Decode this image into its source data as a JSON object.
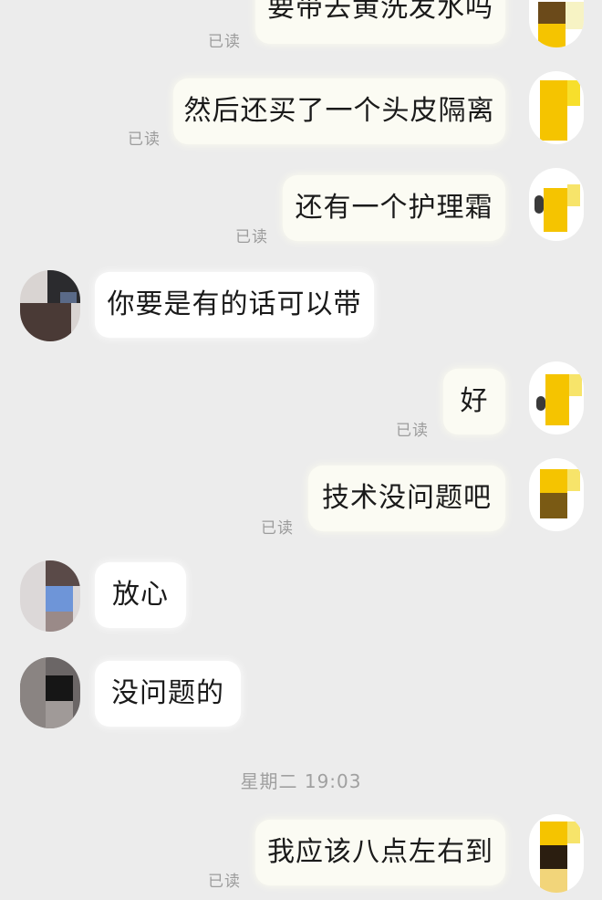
{
  "read_label": "已读",
  "messages": [
    {
      "side": "right",
      "text": "要带去黄洗发水吗"
    },
    {
      "side": "right",
      "text": "然后还买了一个头皮隔离"
    },
    {
      "side": "right",
      "text": "还有一个护理霜"
    },
    {
      "side": "left",
      "text": "你要是有的话可以带"
    },
    {
      "side": "right",
      "text": "好"
    },
    {
      "side": "right",
      "text": "技术没问题吧"
    },
    {
      "side": "left",
      "text": "放心"
    },
    {
      "side": "left",
      "text": "没问题的"
    },
    {
      "side": "right",
      "text": "我应该八点左右到"
    }
  ],
  "timestamp": "星期二 19:03",
  "colors": {
    "background": "#ececec",
    "bubble_self": "#fbfbf3",
    "bubble_other": "#ffffff",
    "read_text": "#9c9c9c",
    "avatar_self_accent": "#f5c400"
  }
}
